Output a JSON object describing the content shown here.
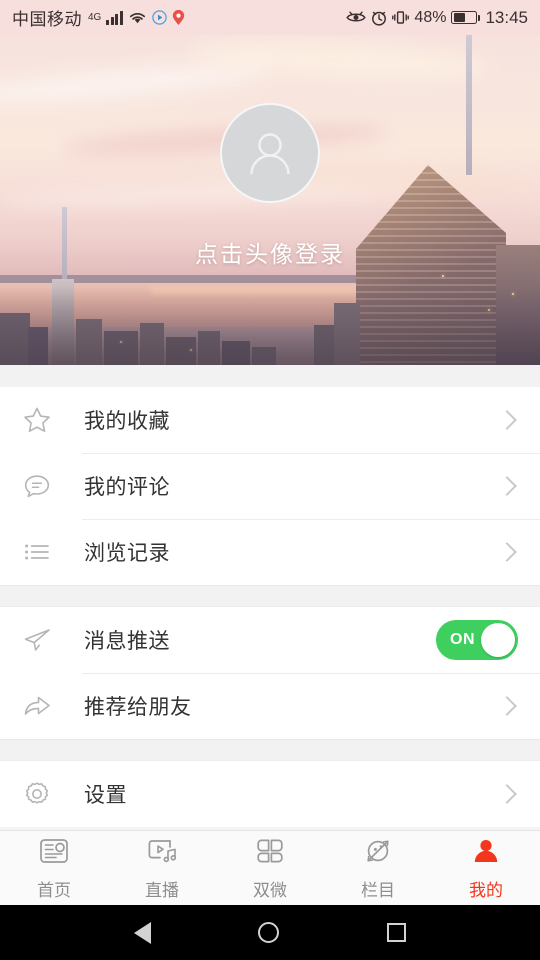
{
  "status_bar": {
    "carrier": "中国移动",
    "network": "4G",
    "battery_percent": "48%",
    "time": "13:45",
    "icons": [
      "signal-bars-icon",
      "wifi-icon",
      "media-play-icon",
      "location-pin-icon",
      "eye-icon",
      "alarm-icon",
      "vibrate-icon",
      "battery-icon"
    ]
  },
  "header": {
    "avatar_icon": "user-avatar-placeholder-icon",
    "login_prompt": "点击头像登录"
  },
  "groups": [
    {
      "rows": [
        {
          "icon": "star-icon",
          "label": "我的收藏",
          "accessory": "chevron"
        },
        {
          "icon": "comment-icon",
          "label": "我的评论",
          "accessory": "chevron"
        },
        {
          "icon": "list-icon",
          "label": "浏览记录",
          "accessory": "chevron"
        }
      ]
    },
    {
      "rows": [
        {
          "icon": "send-icon",
          "label": "消息推送",
          "accessory": "toggle",
          "toggle_state": "ON"
        },
        {
          "icon": "share-icon",
          "label": "推荐给朋友",
          "accessory": "chevron"
        }
      ]
    },
    {
      "rows": [
        {
          "icon": "gear-icon",
          "label": "设置",
          "accessory": "chevron"
        }
      ]
    }
  ],
  "tabbar": {
    "active_color": "#f4361c",
    "inactive_color": "#8e8e8e",
    "tabs": [
      {
        "icon": "news-icon",
        "label": "首页",
        "active": false
      },
      {
        "icon": "live-icon",
        "label": "直播",
        "active": false
      },
      {
        "icon": "grid-icon",
        "label": "双微",
        "active": false
      },
      {
        "icon": "planet-icon",
        "label": "栏目",
        "active": false
      },
      {
        "icon": "person-icon",
        "label": "我的",
        "active": true
      }
    ]
  },
  "android_nav": {
    "back": "back-button",
    "home": "home-button",
    "recents": "recents-button"
  }
}
